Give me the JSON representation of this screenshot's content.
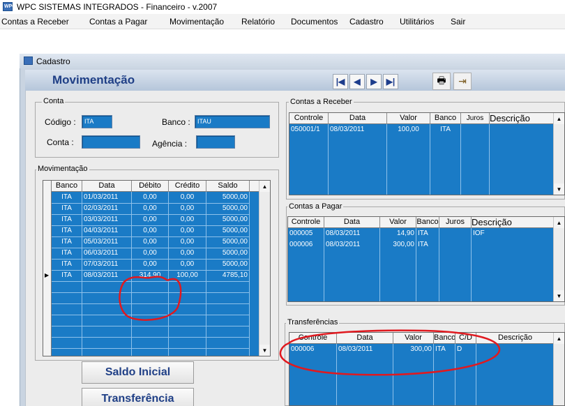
{
  "window": {
    "title": "WPC SISTEMAS INTEGRADOS - Financeiro - v.2007",
    "icon": "wpc-app-icon"
  },
  "menu": [
    "Contas a Receber",
    "Contas a Pagar",
    "Movimentação",
    "Relatório",
    "Documentos",
    "Cadastro",
    "Utilitários",
    "Sair"
  ],
  "child_window": {
    "title": "Cadastro"
  },
  "page_title": "Movimentação",
  "nav_buttons": {
    "first": "first-record-icon",
    "prev": "prev-record-icon",
    "next": "next-record-icon",
    "last": "last-record-icon"
  },
  "tools": {
    "print": "printer-icon",
    "exit": "exit-door-icon"
  },
  "conta_group": {
    "title": "Conta",
    "codigo_label": "Código :",
    "codigo_value": "ITA",
    "banco_label": "Banco :",
    "banco_value": "ITAU",
    "conta_label": "Conta :",
    "conta_value": "",
    "agencia_label": "Agência :",
    "agencia_value": ""
  },
  "movimentacao": {
    "title": "Movimentação",
    "columns": [
      "Banco",
      "Data",
      "Débito",
      "Crédito",
      "Saldo"
    ],
    "rows": [
      [
        "ITA",
        "01/03/2011",
        "0,00",
        "0,00",
        "5000,00"
      ],
      [
        "ITA",
        "02/03/2011",
        "0,00",
        "0,00",
        "5000,00"
      ],
      [
        "ITA",
        "03/03/2011",
        "0,00",
        "0,00",
        "5000,00"
      ],
      [
        "ITA",
        "04/03/2011",
        "0,00",
        "0,00",
        "5000,00"
      ],
      [
        "ITA",
        "05/03/2011",
        "0,00",
        "0,00",
        "5000,00"
      ],
      [
        "ITA",
        "06/03/2011",
        "0,00",
        "0,00",
        "5000,00"
      ],
      [
        "ITA",
        "07/03/2011",
        "0,00",
        "0,00",
        "5000,00"
      ],
      [
        "ITA",
        "08/03/2011",
        "314,90",
        "100,00",
        "4785,10"
      ]
    ]
  },
  "contas_receber": {
    "title": "Contas a Receber",
    "columns": [
      "Controle",
      "Data",
      "Valor",
      "Banco",
      "Juros",
      "Descrição"
    ],
    "rows": [
      [
        "050001/1",
        "08/03/2011",
        "100,00",
        "ITA",
        "",
        ""
      ]
    ]
  },
  "contas_pagar": {
    "title": "Contas a Pagar",
    "columns": [
      "Controle",
      "Data",
      "Valor",
      "Banco",
      "Juros",
      "Descrição"
    ],
    "rows": [
      [
        "000005",
        "08/03/2011",
        "14,90",
        "ITA",
        "",
        "IOF"
      ],
      [
        "000006",
        "08/03/2011",
        "300,00",
        "ITA",
        "",
        ""
      ]
    ]
  },
  "transferencias": {
    "title": "Transferências",
    "columns": [
      "Controle",
      "Data",
      "Valor",
      "Banco",
      "C/D",
      "Descrição"
    ],
    "rows": [
      [
        "000006",
        "08/03/2011",
        "300,00",
        "ITA",
        "D",
        ""
      ]
    ]
  },
  "buttons": {
    "saldo_inicial": "Saldo Inicial",
    "transferencia": "Transferência"
  },
  "colors": {
    "grid_bg": "#1a7bc6",
    "title_blue": "#1f3f86",
    "annotation_red": "#e0191f"
  }
}
